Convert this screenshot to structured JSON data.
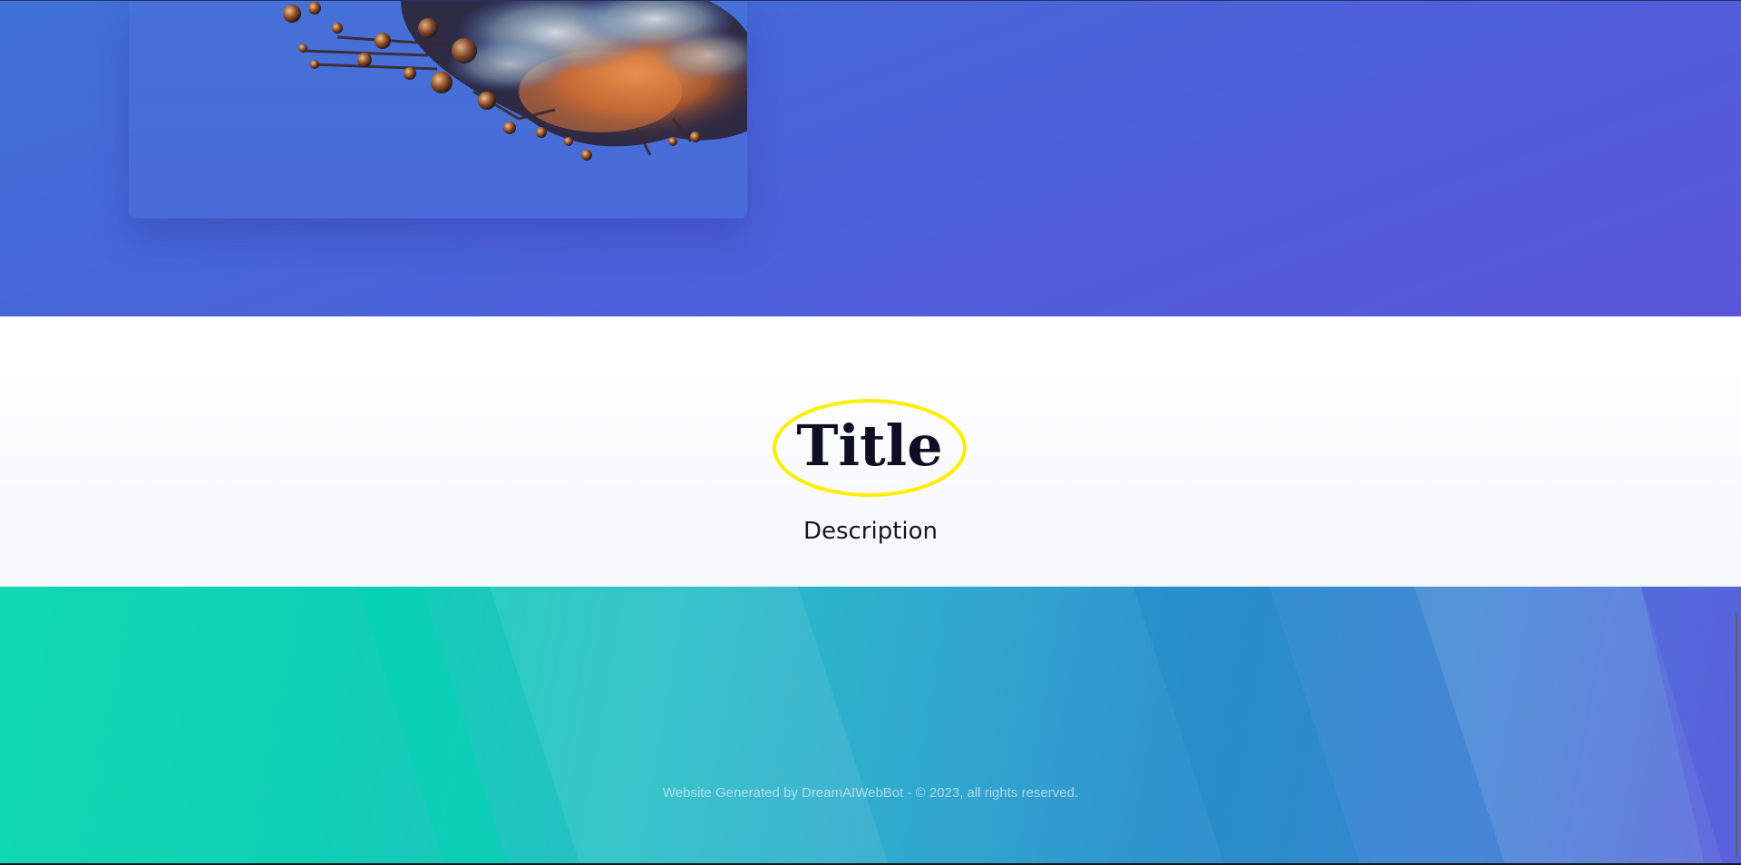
{
  "hero": {
    "image": {
      "icon": "abstract-smoke-machine-illustration"
    }
  },
  "feature": {
    "title": "Title",
    "description": "Description",
    "highlight_color": "#ffee00"
  },
  "footer": {
    "copyright": "Website Generated by DreamAIWebBot - © 2023, all rights reserved."
  },
  "colors": {
    "hero_start": "#3f72d6",
    "hero_end": "#5a56dc",
    "footer_start": "#10d9b1",
    "footer_end": "#5a66dc",
    "title_text": "#0e0f24"
  }
}
